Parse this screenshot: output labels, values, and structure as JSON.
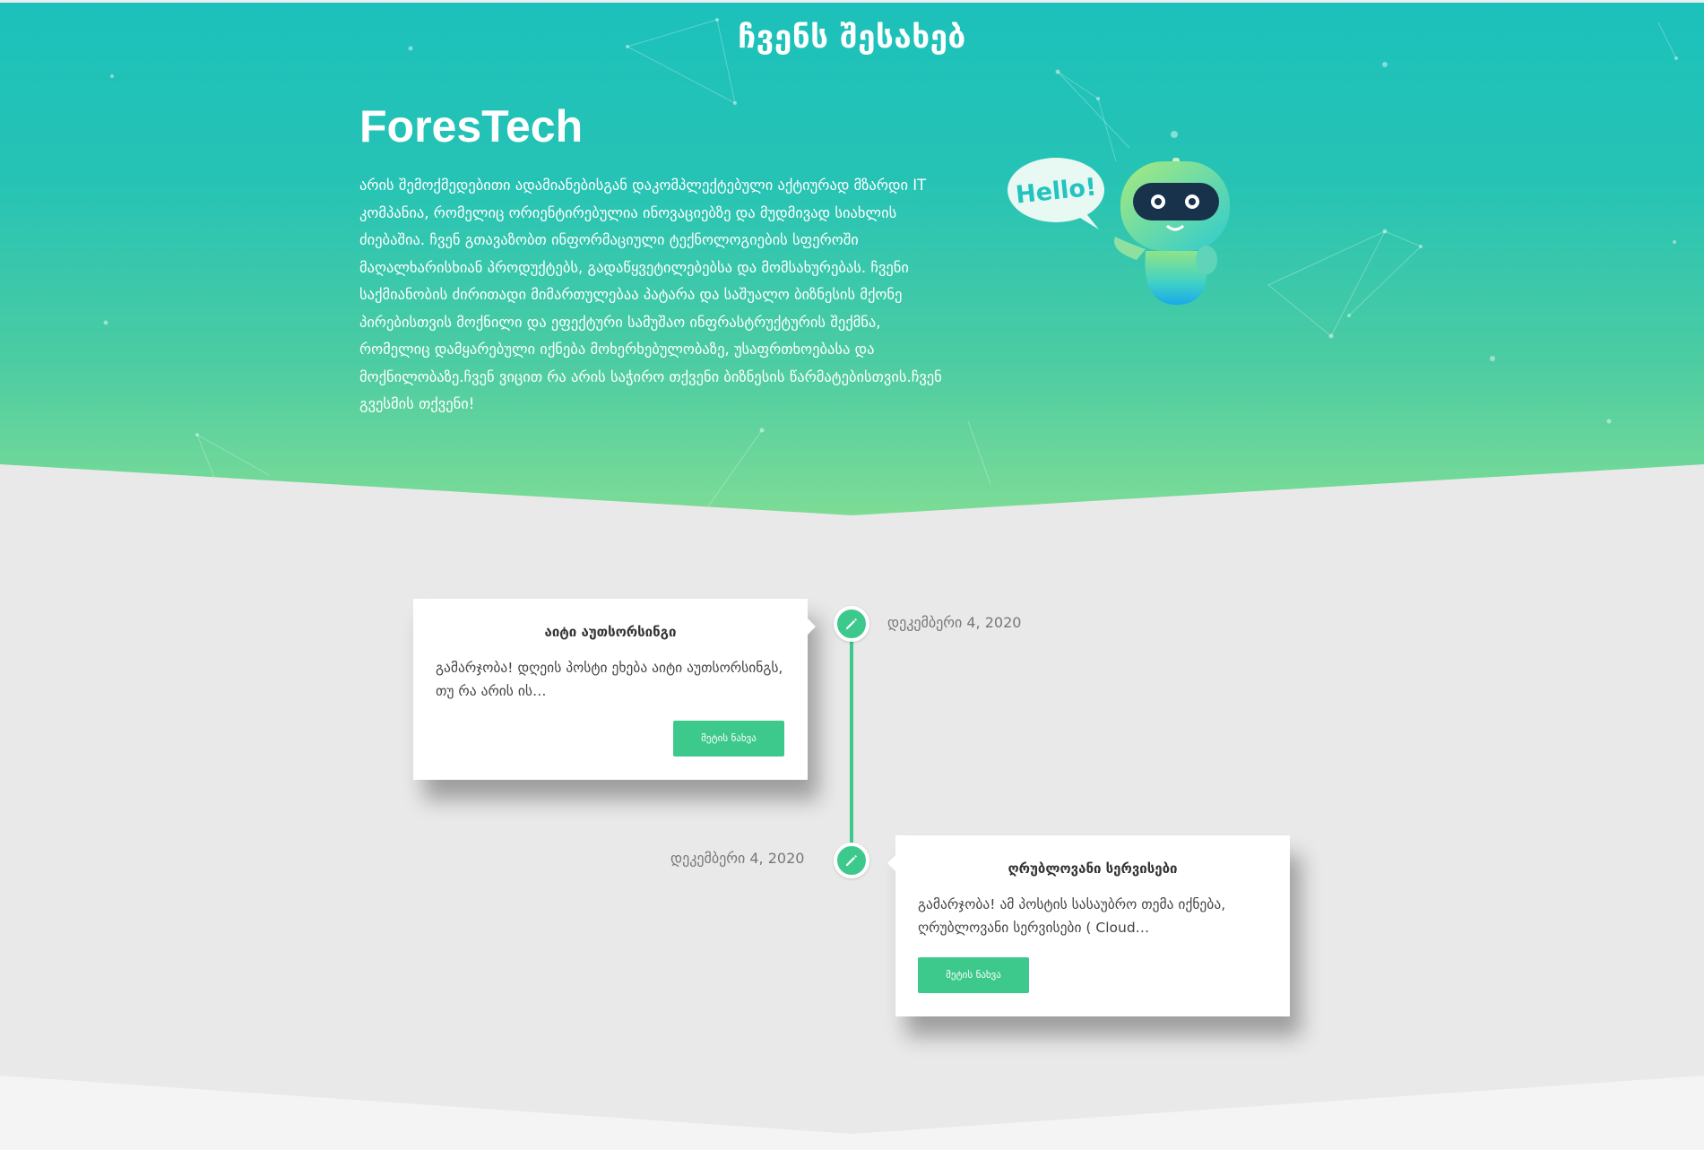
{
  "hero": {
    "section_heading": "ჩვენს შესახებ",
    "brand": "ForesTech",
    "description": "არის შემოქმედებითი   ადამიანებისგან დაკომპლექტებული აქტიურად მზარდი IT კომპანია, რომელიც ორიენტირებულია ინოვაციებზე და მუდმივად სიახლის ძიებაშია. ჩვენ გთავაზობთ ინფორმაციული ტექნოლოგიების სფეროში მაღალხარისხიან პროდუქტებს, გადაწყვეტილებებსა და მომსახურებას. ჩვენი საქმიანობის ძირითადი მიმართულებაა პატარა და საშუალო ბიზნესის მქონე პირებისთვის მოქნილი და ეფექტური სამუშაო ინფრასტრუქტურის შექმნა, რომელიც დამყარებული იქნება მოხერხებულობაზე, უსაფრთხოებასა და მოქნილობაზე.ჩვენ ვიცით რა არის საჭირო თქვენი ბიზნესის წარმატებისთვის.ჩვენ გვესმის თქვენი!",
    "robot_speech": "Hello!"
  },
  "timeline": {
    "posts": [
      {
        "title": "აიტი აუთსორსინგი",
        "excerpt": "გამარჯობა! დღეის პოსტი ეხება აიტი აუთსორსინგს, თუ რა არის ის…",
        "button": "მეტის ნახვა",
        "date": "დეკემბერი 4, 2020"
      },
      {
        "title": "ღრუბლოვანი სერვისები",
        "excerpt": "გამარჯობა! ამ პოსტის სასაუბრო თემა იქნება, ღრუბლოვანი სერვისები ( Cloud…",
        "button": "მეტის ნახვა",
        "date": "დეკემბერი 4, 2020"
      }
    ]
  },
  "colors": {
    "accent": "#3ec98c",
    "hero_top": "#1cc1bb",
    "hero_bottom": "#7ddc96",
    "page_bg": "#e9e9e9"
  },
  "icons": [
    "pencil-icon"
  ]
}
